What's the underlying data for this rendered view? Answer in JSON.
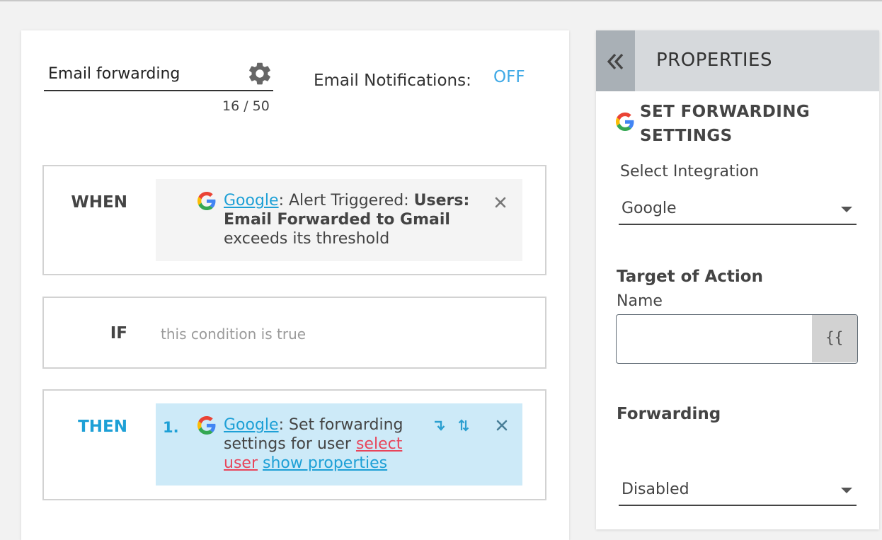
{
  "workflow": {
    "name_value": "Email forwarding",
    "char_counter": "16 / 50",
    "notifications_label": "Email Notifications:",
    "notifications_state": "OFF"
  },
  "when": {
    "label": "WHEN",
    "integration_link": "Google",
    "text_a": ": Alert Triggered: ",
    "text_bold": "Users: Email Forwarded to Gmail",
    "text_b": " exceeds its threshold"
  },
  "if": {
    "label": "IF",
    "placeholder": "this condition is true"
  },
  "then": {
    "label": "THEN",
    "step_number": "1.",
    "integration_link": "Google",
    "text_a": ": Set forwarding settings for user ",
    "select_user_link": "select user",
    "show_properties_link": "show properties"
  },
  "properties": {
    "header_title": "PROPERTIES",
    "section_title": "SET FORWARDING SETTINGS",
    "select_integration_label": "Select Integration",
    "integration_value": "Google",
    "target_heading": "Target of Action",
    "name_label": "Name",
    "name_value": "",
    "variable_button": "{{",
    "forwarding_heading": "Forwarding",
    "forwarding_value": "Disabled"
  },
  "colors": {
    "accent_blue": "#1ea0d6",
    "toggle_blue": "#3fa9e6",
    "link_red": "#e8455b",
    "then_bg": "#cdeaf8",
    "header_bg": "#d6d9dc"
  },
  "icons": [
    "gear-icon",
    "google-logo-icon",
    "close-icon",
    "move-down-icon",
    "reorder-icon",
    "double-chevron-left-icon",
    "caret-down-icon"
  ]
}
